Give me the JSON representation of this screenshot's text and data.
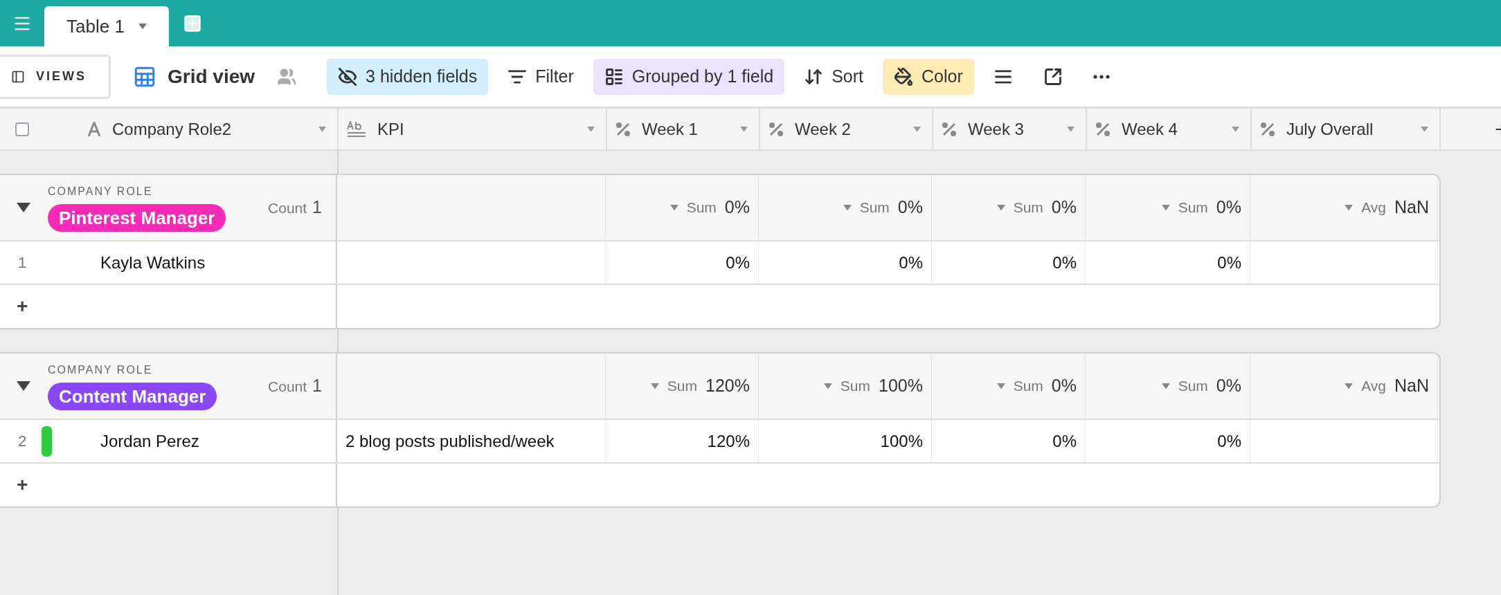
{
  "top_bar": {
    "tabs": [
      {
        "label": "Table 1",
        "selected": true
      }
    ]
  },
  "toolbar": {
    "views_button": "VIEWS",
    "view_name": "Grid view",
    "buttons": [
      {
        "kind": "hide",
        "label": "3 hidden fields",
        "color": "#d1eefa"
      },
      {
        "kind": "filter",
        "label": "Filter"
      },
      {
        "kind": "group",
        "label": "Grouped by 1 field",
        "color": "#ebe2fb"
      },
      {
        "kind": "sort",
        "label": "Sort"
      },
      {
        "kind": "color",
        "label": "Color",
        "color": "#ffeab6"
      },
      {
        "kind": "row_height"
      },
      {
        "kind": "share"
      },
      {
        "kind": "more"
      }
    ]
  },
  "table": {
    "select_all": {
      "checked": false
    },
    "columns": [
      {
        "name": "Company Role2",
        "kind": "text"
      },
      {
        "name": "KPI",
        "kind": "long_text"
      },
      {
        "name": "Week 1",
        "kind": "percent"
      },
      {
        "name": "Week 2",
        "kind": "percent"
      },
      {
        "name": "Week 3",
        "kind": "percent"
      },
      {
        "name": "Week 4",
        "kind": "percent"
      },
      {
        "name": "July Overall",
        "kind": "percent"
      }
    ],
    "groups": [
      {
        "field_label": "COMPANY ROLE",
        "value": "Pinterest Manager",
        "color": "#f82bb8",
        "expanded": true,
        "count_label": "Count",
        "count": "1",
        "summaries": [
          {
            "label": "Sum",
            "value": "0%"
          },
          {
            "label": "Sum",
            "value": "0%"
          },
          {
            "label": "Sum",
            "value": "0%"
          },
          {
            "label": "Sum",
            "value": "0%"
          },
          {
            "label": "Avg",
            "value": "NaN"
          }
        ],
        "rows": [
          {
            "number": "1",
            "cells": [
              "Kayla Watkins",
              null,
              "0%",
              "0%",
              "0%",
              "0%",
              null
            ]
          }
        ],
        "add_row": "+"
      },
      {
        "field_label": "COMPANY ROLE",
        "value": "Content Manager",
        "color": "#8b46ff",
        "expanded": true,
        "count_label": "Count",
        "count": "1",
        "summaries": [
          {
            "label": "Sum",
            "value": "120%"
          },
          {
            "label": "Sum",
            "value": "100%"
          },
          {
            "label": "Sum",
            "value": "0%"
          },
          {
            "label": "Sum",
            "value": "0%"
          },
          {
            "label": "Avg",
            "value": "NaN"
          }
        ],
        "rows": [
          {
            "number": "2",
            "color": "#2ecc40",
            "cells": [
              "Jordan Perez",
              "2 blog posts published/week",
              "120%",
              "100%",
              "0%",
              "0%",
              null
            ]
          }
        ],
        "add_row": "+"
      }
    ]
  }
}
